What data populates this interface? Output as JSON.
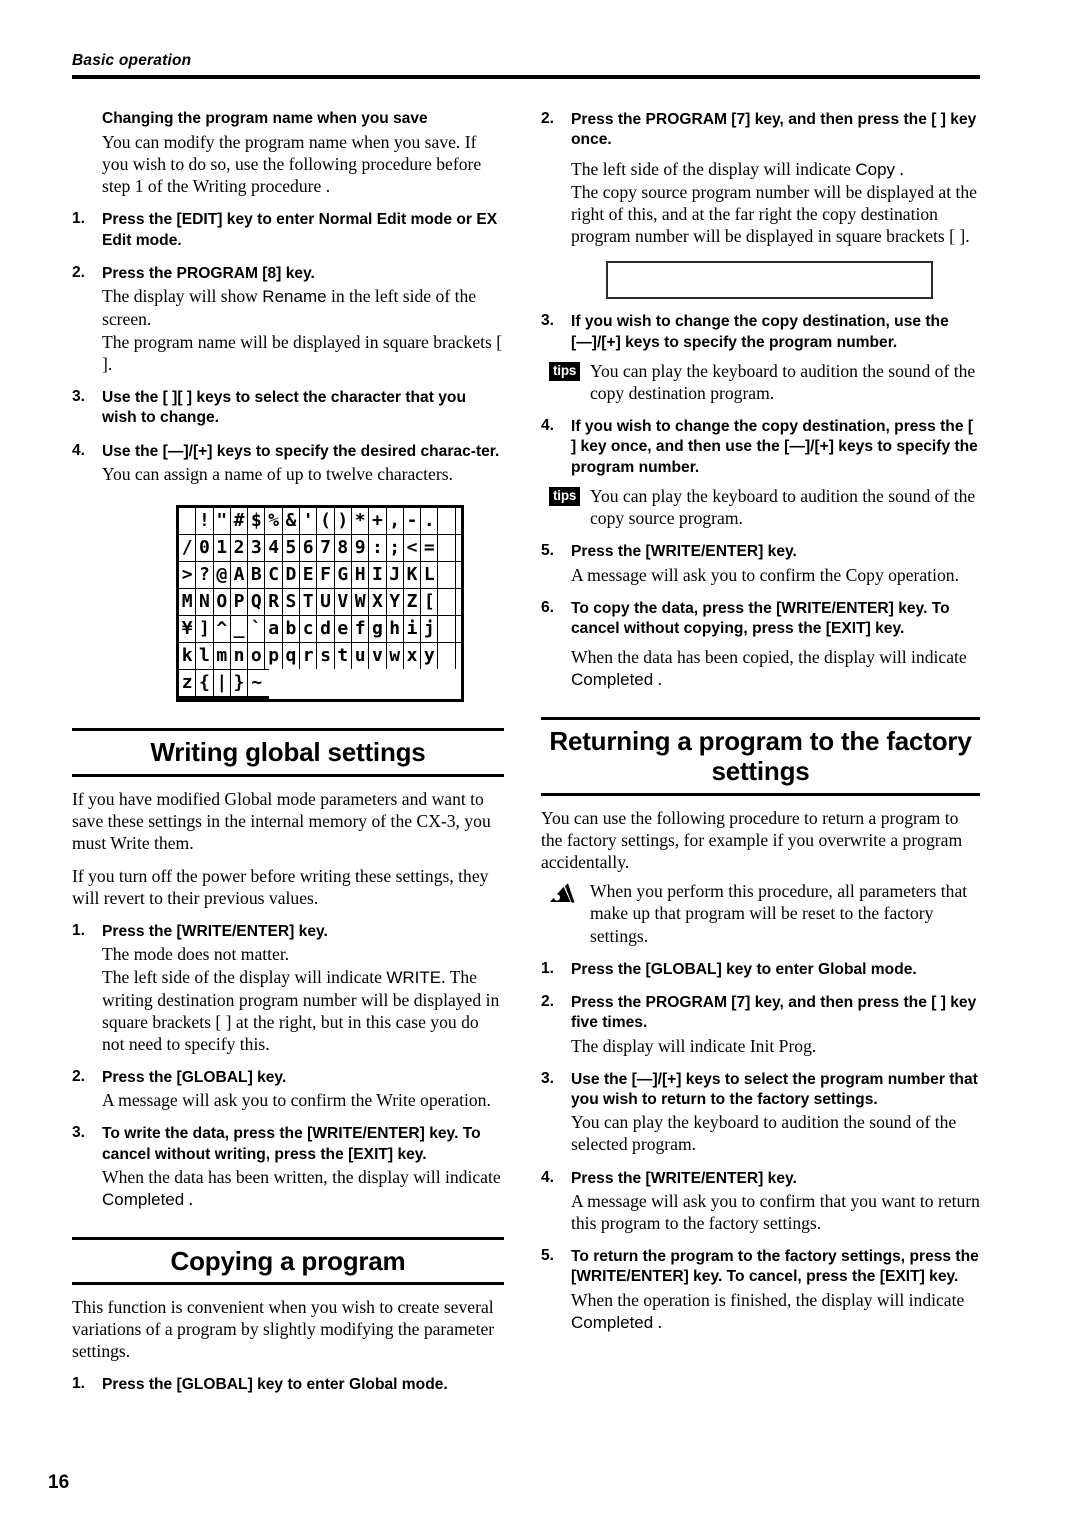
{
  "header": {
    "running_title": "Basic operation"
  },
  "page_number": "16",
  "left_column": {
    "intro": {
      "subheading": "Changing the program name when you save",
      "paragraph": "You can modify the program name when you save. If you wish to do so, use the following procedure before step 1 of the Writing procedure ."
    },
    "rename_steps": [
      {
        "num": "1.",
        "bold": "Press the [EDIT] key to enter Normal Edit mode or EX Edit mode.",
        "body": ""
      },
      {
        "num": "2.",
        "bold": "Press the PROGRAM [8] key.",
        "body_1a": "The display will show ",
        "body_lcd": "Rename",
        "body_1b": " in the left side of the screen.",
        "body_2": "The program name will be displayed in square brackets [ ]."
      },
      {
        "num": "3.",
        "bold": "Use the [   ][   ] keys to select the character that you wish to change.",
        "body": ""
      },
      {
        "num": "4.",
        "bold": "Use the [—]/[+] keys to specify the desired charac-ter.",
        "body": "You can assign a name of up to twelve characters."
      }
    ],
    "char_chart": {
      "name": "LCD character set chart",
      "rows": [
        [
          " ",
          "!",
          "\"",
          "#",
          "$",
          "%",
          "&",
          "'",
          "(",
          ")",
          "*",
          "+",
          ",",
          "-",
          ".",
          ""
        ],
        [
          "/",
          "0",
          "1",
          "2",
          "3",
          "4",
          "5",
          "6",
          "7",
          "8",
          "9",
          ":",
          ";",
          "<",
          "=",
          ""
        ],
        [
          ">",
          "?",
          "@",
          "A",
          "B",
          "C",
          "D",
          "E",
          "F",
          "G",
          "H",
          "I",
          "J",
          "K",
          "L",
          ""
        ],
        [
          "M",
          "N",
          "O",
          "P",
          "Q",
          "R",
          "S",
          "T",
          "U",
          "V",
          "W",
          "X",
          "Y",
          "Z",
          "[",
          ""
        ],
        [
          "¥",
          "]",
          "^",
          "_",
          "`",
          "a",
          "b",
          "c",
          "d",
          "e",
          "f",
          "g",
          "h",
          "i",
          "j",
          ""
        ],
        [
          "k",
          "l",
          "m",
          "n",
          "o",
          "p",
          "q",
          "r",
          "s",
          "t",
          "u",
          "v",
          "w",
          "x",
          "y",
          ""
        ],
        [
          "z",
          "{",
          "|",
          "}",
          "~"
        ]
      ]
    },
    "section_writing": {
      "title": "Writing global settings",
      "para_1": "If you have modified Global mode parameters and want to save these settings in the internal memory of the CX-3, you must Write them.",
      "para_2": "If you turn off the power before writing these settings, they will revert to their previous values.",
      "steps": [
        {
          "num": "1.",
          "bold": "Press the [WRITE/ENTER] key.",
          "body_1": "The mode does not matter.",
          "body_2a": "The left side of the display will indicate ",
          "body_lcd": "WRITE",
          "body_2b": ". The writing destination program number will be displayed in square brackets [ ] at the right, but in this case you do not need to specify this."
        },
        {
          "num": "2.",
          "bold": "Press the [GLOBAL] key.",
          "body": "A message will ask you to confirm the Write operation."
        },
        {
          "num": "3.",
          "bold": "To write the data, press the [WRITE/ENTER] key. To cancel without writing, press the [EXIT] key.",
          "body_a": "When the data has been written, the display will indicate ",
          "body_lcd": "Completed",
          "body_b": " ."
        }
      ]
    },
    "section_copying": {
      "title": "Copying a program",
      "para_1": "This function is convenient when you wish to create several variations of a program by slightly modifying the parameter settings.",
      "steps": [
        {
          "num": "1.",
          "bold": "Press the [GLOBAL] key to enter Global mode."
        }
      ]
    }
  },
  "right_column": {
    "copy_steps": [
      {
        "num": "2.",
        "bold": "Press the PROGRAM [7] key, and then press the [   ] key once.",
        "body_1a": "The left side of the display will indicate ",
        "body_lcd": "Copy",
        "body_1b": " .",
        "body_2": "The copy source program number will be displayed at the right of this, and at the far right the copy destination program number will be displayed in square brackets [ ]."
      },
      {
        "num": "3.",
        "bold": "If you wish to change the copy destination, use the [—]/[+] keys to specify the program number.",
        "tip": "You can play the keyboard to audition the sound of the copy destination program."
      },
      {
        "num": "4.",
        "bold": "If you wish to change the copy destination, press the [   ] key once, and then use the [—]/[+] keys to specify the program number.",
        "tip": "You can play the keyboard to audition the sound of the copy source program."
      },
      {
        "num": "5.",
        "bold": "Press the [WRITE/ENTER] key.",
        "body": "A message will ask you to confirm the Copy operation."
      },
      {
        "num": "6.",
        "bold": "To copy the data, press the [WRITE/ENTER] key. To cancel without copying, press the [EXIT] key.",
        "body_a": "When the data has been copied, the display will indicate ",
        "body_lcd": "Completed",
        "body_b": " ."
      }
    ],
    "tips_label": "tips",
    "figure_placeholder": "",
    "section_factory": {
      "title": "Returning a program to the factory settings",
      "para_1": "You can use the following procedure to return a program to the factory settings, for example if you overwrite a program accidentally.",
      "note": "When you perform this procedure, all parameters that make up that program will be reset to the factory settings.",
      "steps": [
        {
          "num": "1.",
          "bold": "Press the [GLOBAL] key to enter Global mode."
        },
        {
          "num": "2.",
          "bold": "Press the PROGRAM [7] key, and then press the [   ] key five times.",
          "body": "The display will indicate Init Prog."
        },
        {
          "num": "3.",
          "bold": "Use the [—]/[+] keys to select the program number that you wish to return to the factory settings.",
          "body": "You can play the keyboard to audition the sound of the selected program."
        },
        {
          "num": "4.",
          "bold": "Press the [WRITE/ENTER] key.",
          "body": "A message will ask you to confirm that you want to return this program to the factory settings."
        },
        {
          "num": "5.",
          "bold": "To return the program to the factory settings, press the [WRITE/ENTER] key. To cancel, press the [EXIT] key.",
          "body_a": "When the operation is finished, the display will indicate ",
          "body_lcd": "Completed",
          "body_b": " ."
        }
      ]
    }
  },
  "colors": {
    "ink": "#000000",
    "paper": "#ffffff",
    "frame": "#2b2b2b"
  }
}
